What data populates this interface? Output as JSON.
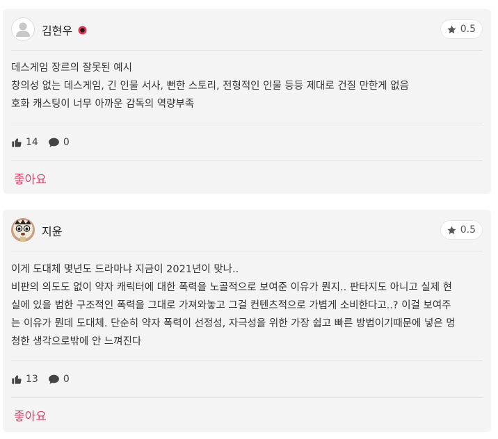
{
  "colors": {
    "card_background": "#f4f4f5",
    "like_accent": "#e03e6c",
    "icon_gray": "#555555"
  },
  "reviews": [
    {
      "user": {
        "name": "김현우",
        "avatar": "default-person-icon",
        "badge": "verified-badge-icon"
      },
      "rating": "0.5",
      "lines": [
        "데스게임 장르의 잘못된 예시",
        "창의성 없는 데스게임, 긴 인물 서사, 뻔한 스토리, 전형적인 인물 등등 제대로 건질 만한게 없음",
        "호화 캐스팅이 너무 아까운 감독의 역량부족"
      ],
      "likes": "14",
      "comments": "0",
      "like_label": "좋아요"
    },
    {
      "user": {
        "name": "지윤",
        "avatar": "profile-photo"
      },
      "rating": "0.5",
      "lines": [
        "이게 도대체 몇년도 드라마냐 지금이 2021년이 맞나..",
        "비판의 의도도 없이 약자 캐릭터에 대한 폭력을 노골적으로 보여준 이유가 뭔지.. 판타지도 아니고 실제 현",
        "실에 있을 법한 구조적인 폭력을 그대로 가져와놓고 그걸 컨텐츠적으로 가볍게 소비한다고..? 이걸 보여주",
        "는 이유가 뭔데 도대체. 단순히 약자 폭력이 선정성, 자극성을 위한 가장 쉽고 빠른 방법이기때문에 넣은 멍",
        "청한 생각으로밖에 안 느껴진다"
      ],
      "likes": "13",
      "comments": "0",
      "like_label": "좋아요"
    }
  ]
}
